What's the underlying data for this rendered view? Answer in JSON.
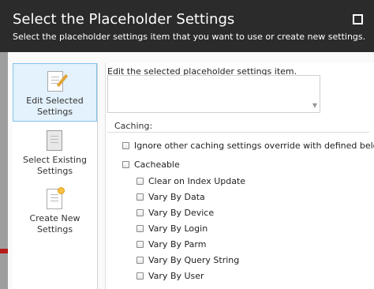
{
  "dialog": {
    "title": "Select the Placeholder Settings",
    "subtitle": "Select the placeholder settings item that you want to use or create new settings."
  },
  "nav": {
    "items": [
      {
        "label": "Edit Selected Settings",
        "icon": "edit-document-icon",
        "active": true
      },
      {
        "label": "Select Existing Settings",
        "icon": "document-list-icon",
        "active": false
      },
      {
        "label": "Create New Settings",
        "icon": "new-document-icon",
        "active": false
      }
    ]
  },
  "panel": {
    "heading": "Edit the selected placeholder settings item.",
    "textarea_value": "",
    "caching_label": "Caching:",
    "options": {
      "ignore_override": {
        "label": "Ignore other caching settings override with defined below",
        "checked": false
      },
      "cacheable": {
        "label": "Cacheable",
        "checked": false
      },
      "sub": [
        {
          "label": "Clear on Index Update",
          "checked": false
        },
        {
          "label": "Vary By Data",
          "checked": false
        },
        {
          "label": "Vary By Device",
          "checked": false
        },
        {
          "label": "Vary By Login",
          "checked": false
        },
        {
          "label": "Vary By Parm",
          "checked": false
        },
        {
          "label": "Vary By Query String",
          "checked": false
        },
        {
          "label": "Vary By User",
          "checked": false
        }
      ]
    }
  },
  "colors": {
    "header_bg": "#2b2b2b",
    "nav_active_bg": "#e3f2fc",
    "nav_active_border": "#7fc3ee"
  }
}
